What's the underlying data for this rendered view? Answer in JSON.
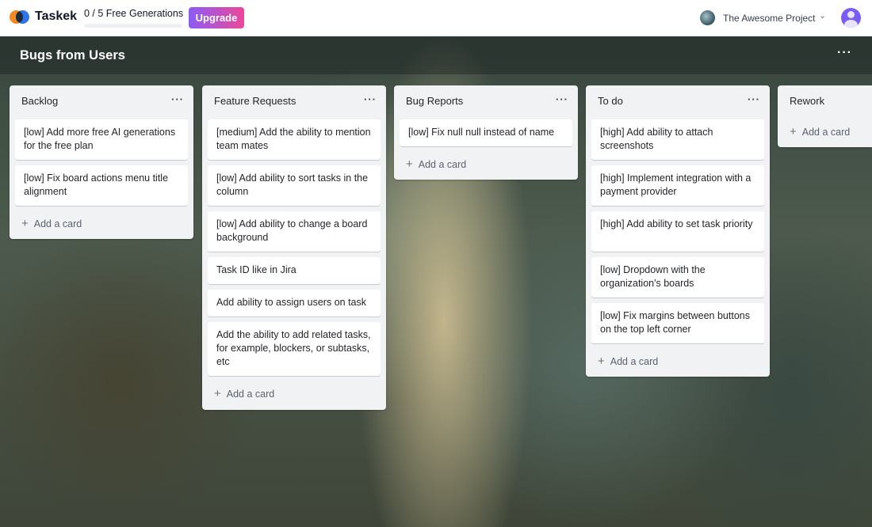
{
  "app": {
    "brand": "Taskek",
    "generations": "0 / 5 Free Generations",
    "upgrade_label": "Upgrade",
    "project_name": "The Awesome Project"
  },
  "board": {
    "title": "Bugs from Users",
    "menu": "···",
    "add_card_label": "Add a card",
    "lists": [
      {
        "title": "Backlog",
        "cards": [
          "[low] Add more free AI generations for the free plan",
          "[low] Fix board actions menu title alignment"
        ]
      },
      {
        "title": "Feature Requests",
        "cards": [
          "[medium] Add the ability to mention team mates",
          "[low] Add ability to sort tasks in the column",
          "[low] Add ability to change a board background",
          "Task ID like in Jira",
          "Add ability to assign users on task",
          "Add the ability to add related tasks, for example, blockers, or subtasks, etc"
        ]
      },
      {
        "title": "Bug Reports",
        "cards": [
          "[low] Fix null null instead of name"
        ]
      },
      {
        "title": "To do",
        "cards": [
          "[high] Add ability to attach screenshots",
          "[high] Implement integration with a payment provider",
          "[high] Add ability to set task priority",
          "[low] Dropdown with the organization's boards",
          "[low] Fix margins between buttons on the top left corner"
        ]
      },
      {
        "title": "Rework",
        "cards": []
      }
    ]
  },
  "colors": {
    "upgrade_gradient_start": "#8b5cf6",
    "upgrade_gradient_end": "#ec4899",
    "list_background": "#f1f2f4",
    "avatar": "#7b5cf5"
  },
  "icons": [
    "taskek-logo-icon",
    "project-avatar-icon",
    "chevron-down-icon",
    "user-avatar-icon",
    "more-horizontal-icon",
    "plus-icon"
  ]
}
